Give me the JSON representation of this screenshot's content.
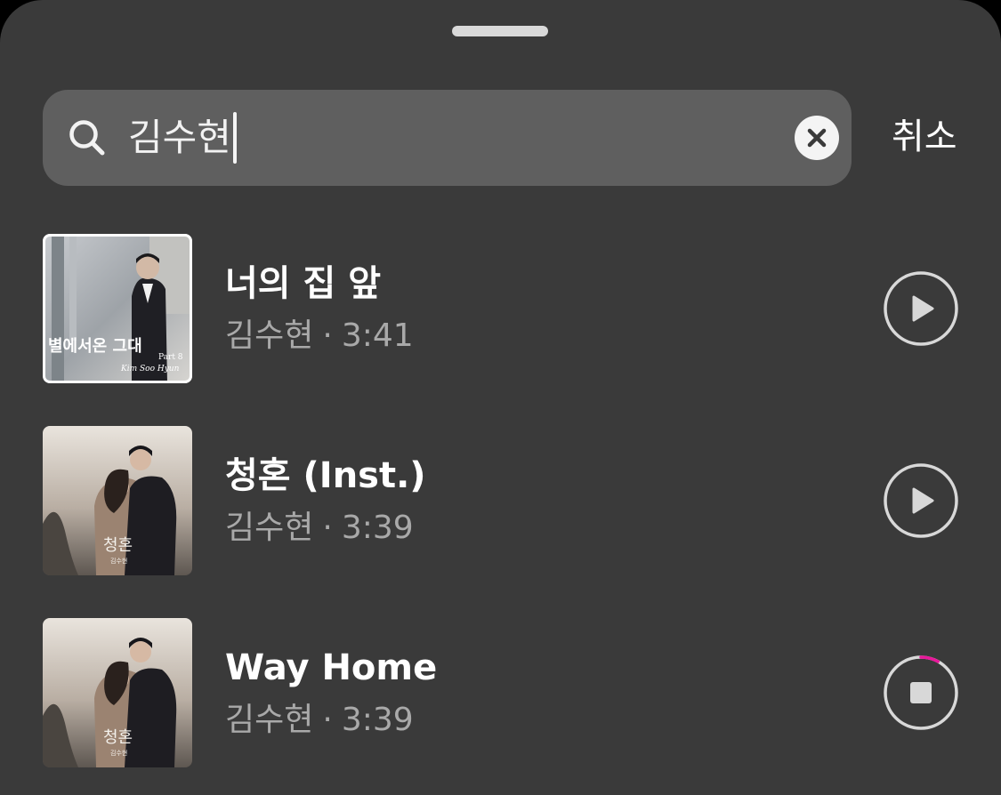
{
  "search": {
    "query": "김수현",
    "cancel_label": "취소"
  },
  "tracks": [
    {
      "title": "너의 집 앞",
      "artist": "김수현",
      "separator": "·",
      "duration": "3:41",
      "state": "stopped",
      "art": {
        "title": "별에서온 그대",
        "caption": "Kim Soo Hyun",
        "part": "Part 8"
      }
    },
    {
      "title": "청혼 (Inst.)",
      "artist": "김수현",
      "separator": "·",
      "duration": "3:39",
      "state": "stopped",
      "art": {
        "title": "청혼",
        "caption": "김수현"
      }
    },
    {
      "title": "Way Home",
      "artist": "김수현",
      "separator": "·",
      "duration": "3:39",
      "state": "playing",
      "progress": 0.08,
      "art": {
        "title": "청혼",
        "caption": "김수현"
      }
    }
  ],
  "colors": {
    "sheet_bg": "#3a3a3a",
    "search_bg": "#5f5f5f",
    "secondary_text": "#a9a9a9",
    "progress_accent": "#e8189a"
  }
}
